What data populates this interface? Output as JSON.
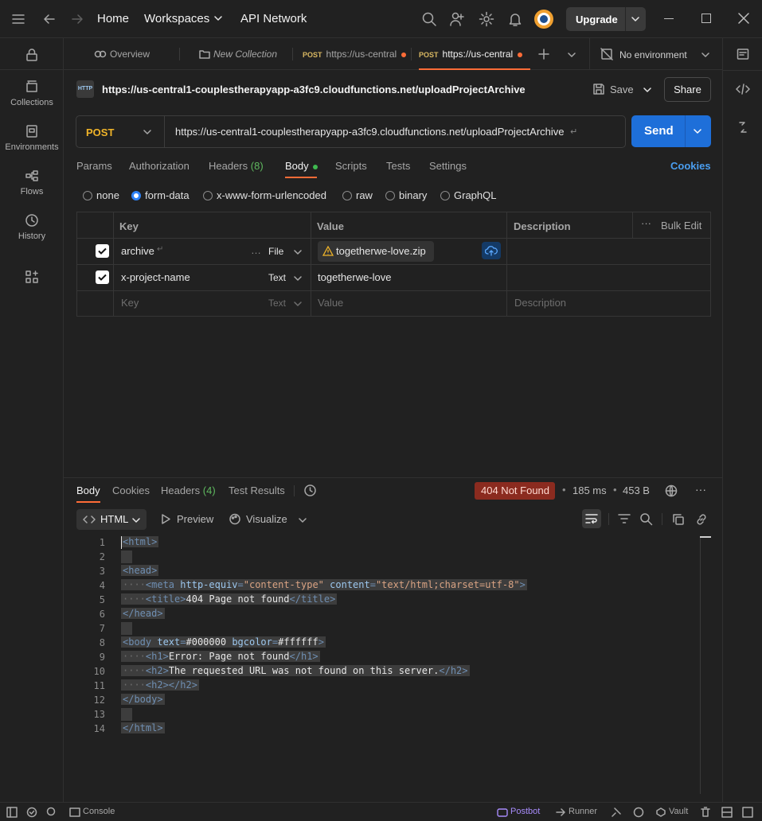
{
  "topbar": {
    "home": "Home",
    "workspaces": "Workspaces",
    "api_network": "API Network",
    "upgrade": "Upgrade"
  },
  "sidebar": {
    "items": [
      {
        "label": "Collections",
        "icon": "collections-icon"
      },
      {
        "label": "Environments",
        "icon": "environments-icon"
      },
      {
        "label": "Flows",
        "icon": "flows-icon"
      },
      {
        "label": "History",
        "icon": "history-icon"
      }
    ]
  },
  "tabs": {
    "overview": "Overview",
    "new_collection": "New Collection",
    "tab1_method": "POST",
    "tab1_url": "https://us-central",
    "tab2_method": "POST",
    "tab2_url": "https://us-central",
    "environment": "No environment"
  },
  "request": {
    "title_url": "https://us-central1-couplestherapyapp-a3fc9.cloudfunctions.net/uploadProjectArchive",
    "save": "Save",
    "share": "Share",
    "method": "POST",
    "url": "https://us-central1-couplestherapyapp-a3fc9.cloudfunctions.net/uploadProjectArchive",
    "send": "Send",
    "tabs": {
      "params": "Params",
      "authorization": "Authorization",
      "headers": "Headers",
      "headers_count": "(8)",
      "body": "Body",
      "scripts": "Scripts",
      "tests": "Tests",
      "settings": "Settings",
      "cookies": "Cookies"
    },
    "body_types": {
      "none": "none",
      "form_data": "form-data",
      "urlencoded": "x-www-form-urlencoded",
      "raw": "raw",
      "binary": "binary",
      "graphql": "GraphQL"
    },
    "table": {
      "headers": {
        "key": "Key",
        "value": "Value",
        "description": "Description",
        "bulk_edit": "Bulk Edit"
      },
      "rows": [
        {
          "key": "archive",
          "type": "File",
          "value": "togetherwe-love.zip"
        },
        {
          "key": "x-project-name",
          "type": "Text",
          "value": "togetherwe-love"
        }
      ],
      "placeholder": {
        "key": "Key",
        "type": "Text",
        "value": "Value",
        "description": "Description"
      }
    }
  },
  "response": {
    "tabs": {
      "body": "Body",
      "cookies": "Cookies",
      "headers": "Headers",
      "headers_count": "(4)",
      "test_results": "Test Results"
    },
    "status": "404 Not Found",
    "time": "185 ms",
    "size": "453 B",
    "format": "HTML",
    "preview": "Preview",
    "visualize": "Visualize",
    "code_lines": [
      {
        "n": "1"
      },
      {
        "n": "2"
      },
      {
        "n": "3"
      },
      {
        "n": "4"
      },
      {
        "n": "5"
      },
      {
        "n": "6"
      },
      {
        "n": "7"
      },
      {
        "n": "8"
      },
      {
        "n": "9"
      },
      {
        "n": "10"
      },
      {
        "n": "11"
      },
      {
        "n": "12"
      },
      {
        "n": "13"
      },
      {
        "n": "14"
      }
    ],
    "code": {
      "l1": "<html>",
      "l3": "<head>",
      "l4_tag": "<meta",
      "l4_a1": "http-equiv",
      "l4_v1": "\"content-type\"",
      "l4_a2": "content",
      "l4_v2": "\"text/html;charset=utf-8\"",
      "l4_end": ">",
      "l5_open": "<title>",
      "l5_text": "404 Page not found",
      "l5_close": "</title>",
      "l6": "</head>",
      "l8_tag": "<body",
      "l8_a1": "text",
      "l8_v1": "#000000",
      "l8_a2": "bgcolor",
      "l8_v2": "#ffffff",
      "l8_end": ">",
      "l9_open": "<h1>",
      "l9_text": "Error: Page not found",
      "l9_close": "</h1>",
      "l10_open": "<h2>",
      "l10_text": "The requested URL was not found on this server.",
      "l10_close": "</h2>",
      "l11": "<h2></h2>",
      "l12": "</body>",
      "l14": "</html>"
    }
  },
  "statusbar": {
    "console": "Console",
    "postbot": "Postbot",
    "runner": "Runner",
    "vault": "Vault"
  },
  "colors": {
    "accent_blue": "#1e6fd9",
    "brand_orange": "#ff6c37",
    "status_error_bg": "#8b2b1f",
    "post_method": "#f0b429"
  }
}
